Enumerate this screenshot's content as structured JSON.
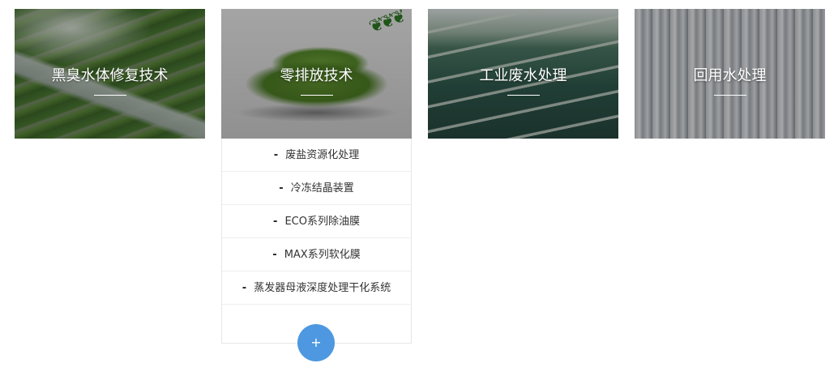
{
  "cards": [
    {
      "title": "黑臭水体修复技术"
    },
    {
      "title": "零排放技术"
    },
    {
      "title": "工业废水处理"
    },
    {
      "title": "回用水处理"
    }
  ],
  "dropdown": {
    "bullet": "-",
    "items": [
      {
        "label": "废盐资源化处理"
      },
      {
        "label": "冷冻结晶装置"
      },
      {
        "label": "ECO系列除油膜"
      },
      {
        "label": "MAX系列软化膜"
      },
      {
        "label": "蒸发器母液深度处理干化系统"
      }
    ]
  },
  "more_button": {
    "label": "+"
  },
  "colors": {
    "accent": "#4d98e0",
    "title_text": "#ffffff",
    "item_text": "#333333"
  }
}
